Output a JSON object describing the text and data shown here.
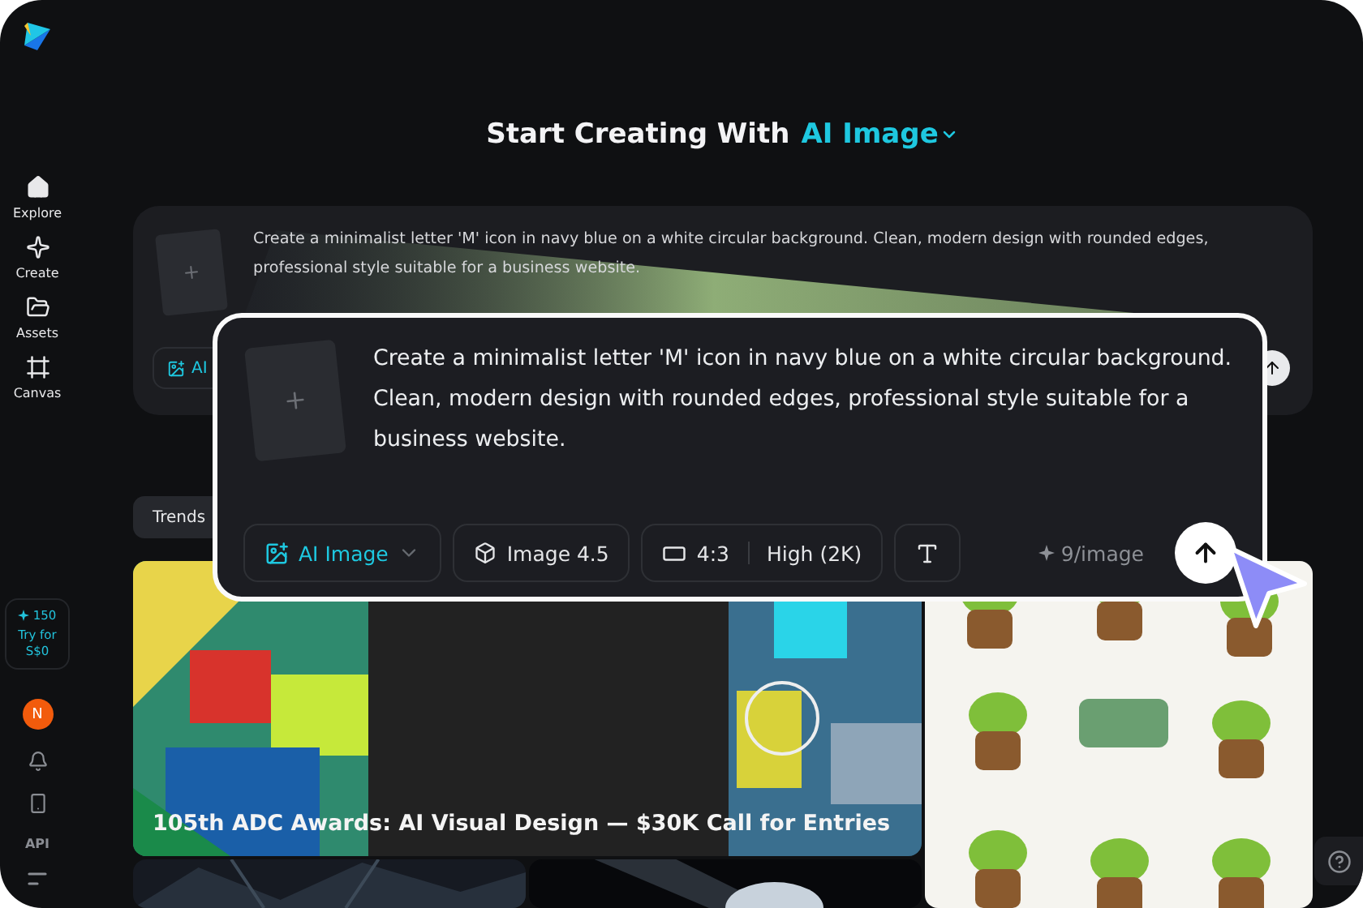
{
  "sidebar": {
    "nav": [
      {
        "label": "Explore",
        "kind": "home"
      },
      {
        "label": "Create",
        "kind": "create"
      },
      {
        "label": "Assets",
        "kind": "assets"
      },
      {
        "label": "Canvas",
        "kind": "canvas"
      }
    ],
    "credits": {
      "amount": "150",
      "offer": "Try for S$0"
    },
    "avatar": "N",
    "api_label": "API"
  },
  "heading": {
    "prefix": "Start Creating With",
    "mode": "AI Image"
  },
  "prompt_card": {
    "text": "Create a minimalist letter 'M' icon in navy blue on a white circular background. Clean, modern design with rounded edges, professional style suitable for a business website.",
    "mode_chip": "AI"
  },
  "tabs": [
    {
      "label": "Trends",
      "selected": true
    }
  ],
  "gallery": [
    {
      "kind": "poster",
      "caption": "105th ADC Awards: AI Visual Design — $30K Call for Entries"
    },
    {
      "kind": "frogs"
    },
    {
      "kind": "dark"
    },
    {
      "kind": "sphere"
    }
  ],
  "zoom_panel": {
    "text": "Create a minimalist letter 'M' icon in navy blue on a white circular background. Clean, modern design with rounded edges, professional style suitable for a business website.",
    "mode": "AI Image",
    "model": "Image 4.5",
    "ratio": "4:3",
    "quality": "High (2K)",
    "cost": "9/image"
  }
}
